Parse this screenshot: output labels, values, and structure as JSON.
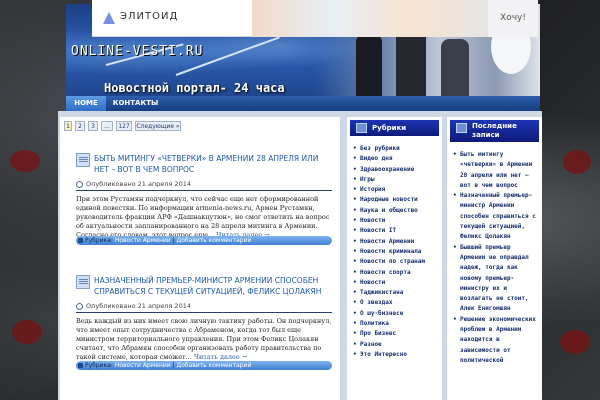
{
  "ad": {
    "brand": "ЭЛИТОИД",
    "cta": "Хочу!"
  },
  "header": {
    "site_name": "ONLINE-VESTI.RU",
    "tagline": "Новостной портал- 24 часа"
  },
  "nav": {
    "items": [
      {
        "label": "HOME"
      },
      {
        "label": "КОНТАКТЫ"
      }
    ]
  },
  "pager": {
    "pages": [
      "1",
      "2",
      "3",
      "...",
      "127"
    ],
    "next": "Следующие »"
  },
  "posts": [
    {
      "title": "Быть митингу «четверки» в Армении 28 апреля или нет – вот в чем вопрос",
      "date": "Опубликовано 21 апреля 2014",
      "excerpt": "При этом Рустамян подчеркнул, что сейчас еще нет сформированной единой повестки. По информации armenia-news.ru, Армен Рустамян, руководитель фракции АРФ «Дашнакцутюн», не смог ответить на вопрос об актуальности запланированного на 28 апреля митинга в Армении. Согласно его словам, этот вопрос еще...",
      "readmore": "Читать далее →",
      "category_prefix": "Рубрика:",
      "category": "Новости Армении",
      "comment": "Добавить комментарий"
    },
    {
      "title": "Назначенный премьер-министр Армении способен справиться с текущей ситуацией, Феликс Цолакян",
      "date": "Опубликовано 21 апреля 2014",
      "excerpt": "Ведь каждый из них имеет свою личную тактику работы. Он подчеркнул, что имеет опыт сотрудничества с Абраменом, когда тот был еще министром территориального управления. При этом Феликс Цолакян считает, что Абрамян способен организовать работу правительства по такой системе, которая сможет...",
      "readmore": "Читать далее →",
      "category_prefix": "Рубрика:",
      "category": "Новости Армении",
      "comment": "Добавить комментарий"
    }
  ],
  "sidebar_categories": {
    "title": "Рубрики",
    "items": [
      "Без рубрики",
      "Видео дня",
      "Здравоохранение",
      "Игры",
      "История",
      "Народные новости",
      "Наука и общество",
      "Новости",
      "Новости IT",
      "Новости Армении",
      "Новости криминала",
      "Новости по странам",
      "Новости спорта",
      "Новости",
      "Таджикистана",
      "О звездах",
      "О шу-бизнесе",
      "Политика",
      "Про Бизнес",
      "Разное",
      "Это Интересно"
    ]
  },
  "sidebar_recent": {
    "title_line1": "Последние",
    "title_line2": "записи",
    "items": [
      "Быть митингу «четверки» в Армении 28 апреля или нет – вот в чем вопрос",
      "Назначенный премьер-министр Армении способен справиться с текущей ситуацией, Феликс Цолакян",
      "Бывший премьер Армении не оправдал надеж, тогда как новому премьер-министру их и возлагать не стоит, Алек Енигомшян",
      "Решение экономических проблем в Армении находится в зависимости от политической"
    ]
  },
  "colors": {
    "header_blue": "#1d3f86",
    "link_blue": "#1f59a8",
    "widget_title": "#0d1b7a",
    "meta_bar": "#3f80d2"
  }
}
